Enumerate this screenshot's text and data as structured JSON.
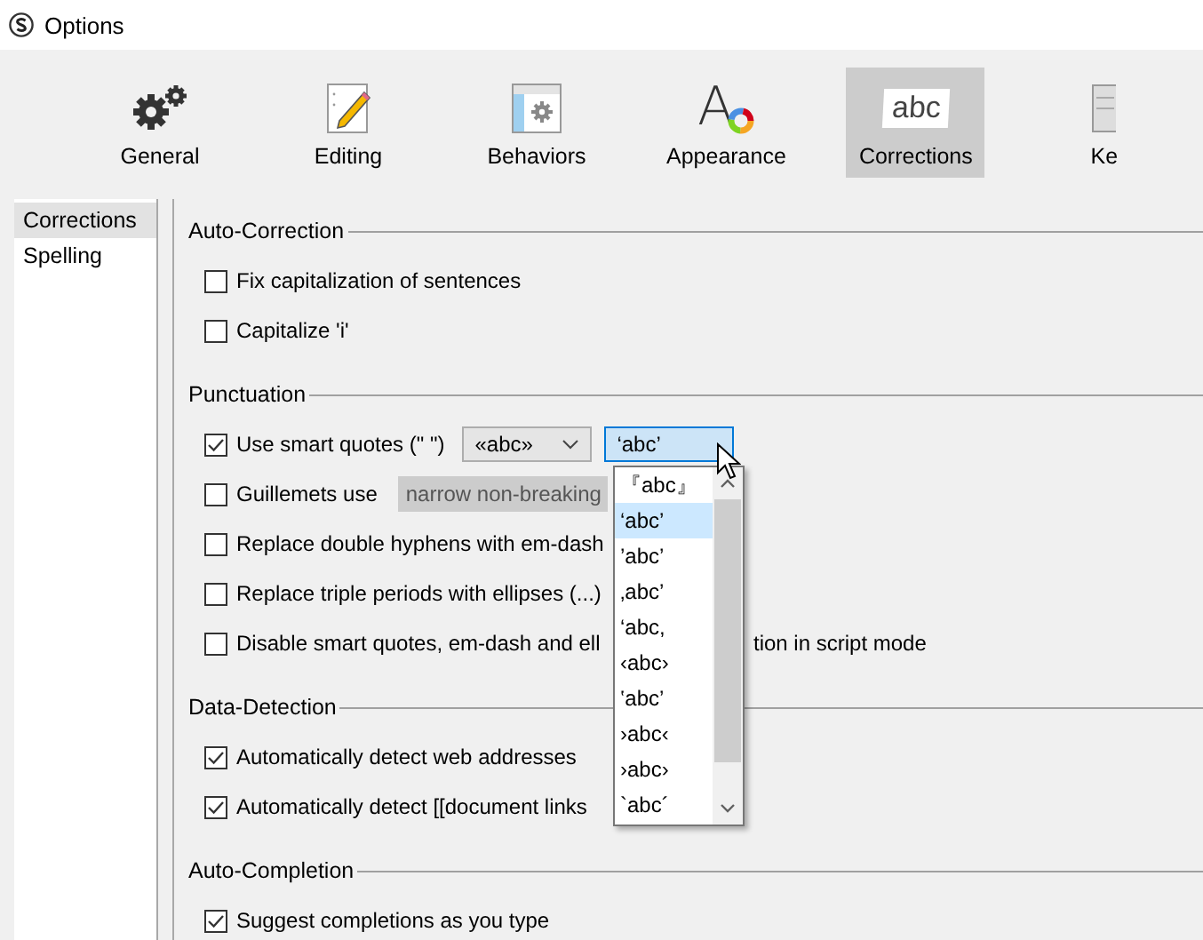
{
  "window": {
    "title": "Options"
  },
  "toolbar": {
    "tabs": [
      {
        "label": "General",
        "selected": false
      },
      {
        "label": "Editing",
        "selected": false
      },
      {
        "label": "Behaviors",
        "selected": false
      },
      {
        "label": "Appearance",
        "icon_text": "A",
        "selected": false
      },
      {
        "label": "Corrections",
        "icon_text": "abc",
        "selected": true
      },
      {
        "label": "Ke",
        "selected": false
      }
    ]
  },
  "sidebar": {
    "items": [
      {
        "label": "Corrections",
        "selected": true
      },
      {
        "label": "Spelling",
        "selected": false
      }
    ]
  },
  "sections": [
    {
      "title": "Auto-Correction",
      "rows": [
        {
          "kind": "checkbox",
          "label": "Fix capitalization of sentences",
          "checked": false
        },
        {
          "kind": "checkbox",
          "label": "Capitalize 'i'",
          "checked": false
        }
      ]
    },
    {
      "title": "Punctuation",
      "rows": [
        {
          "kind": "quotes",
          "label": "Use smart quotes (\" \")",
          "checked": true,
          "double_quotes": "«abc»",
          "single_quotes": "‘abc’"
        },
        {
          "kind": "guillemets",
          "label": "Guillemets use",
          "checked": false,
          "spacing": "narrow non-breaking"
        },
        {
          "kind": "covered",
          "label": "Replace double hyphens with em-dash",
          "checked": false
        },
        {
          "kind": "covered",
          "label": "Replace triple periods with ellipses (...)",
          "checked": false
        },
        {
          "kind": "covered",
          "label": "Disable smart quotes, em-dash and ell",
          "label_rest": "tion in script mode",
          "checked": false
        }
      ]
    },
    {
      "title": "Data-Detection",
      "rows": [
        {
          "kind": "checkbox",
          "label": "Automatically detect web addresses",
          "checked": true
        },
        {
          "kind": "covered",
          "label": "Automatically detect [[document links",
          "checked": true
        }
      ]
    },
    {
      "title": "Auto-Completion",
      "rows": [
        {
          "kind": "checkbox",
          "label": "Suggest completions as you type",
          "checked": true
        }
      ]
    }
  ],
  "dropdown": {
    "items": [
      {
        "label": "『abc』",
        "selected": false
      },
      {
        "label": "‘abc’",
        "selected": true
      },
      {
        "label": "’abc’",
        "selected": false
      },
      {
        "label": "‚abc’",
        "selected": false
      },
      {
        "label": "‘abc,",
        "selected": false
      },
      {
        "label": "‹abc›",
        "selected": false
      },
      {
        "label": "‛abc’",
        "selected": false
      },
      {
        "label": "›abc‹",
        "selected": false
      },
      {
        "label": "›abc›",
        "selected": false
      },
      {
        "label": "`abc´",
        "selected": false
      }
    ]
  }
}
